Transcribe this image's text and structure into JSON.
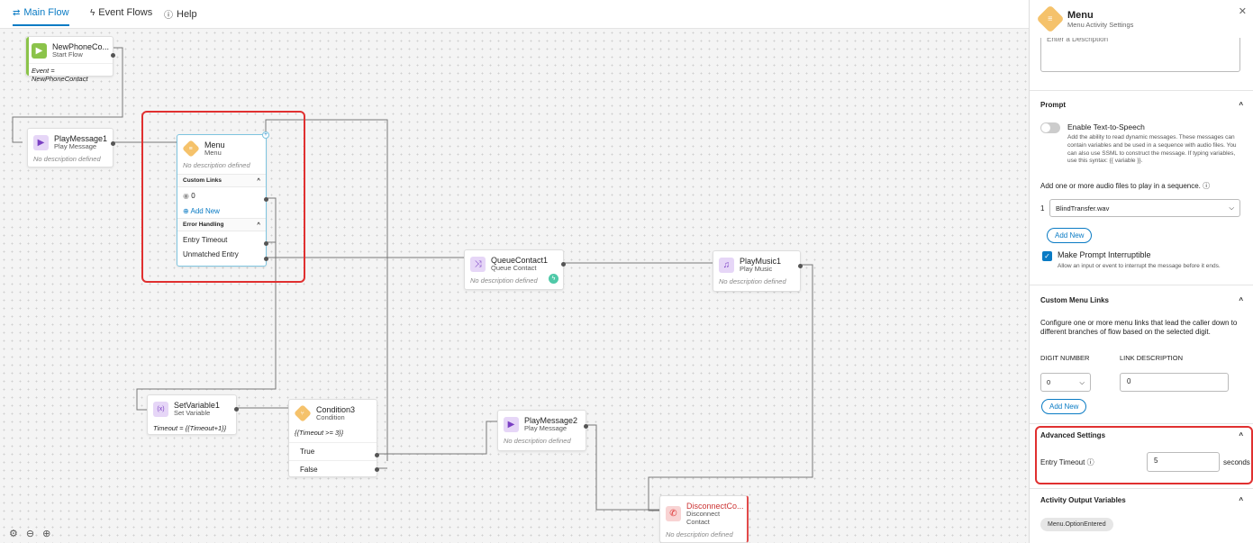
{
  "tabs": [
    {
      "label": "Main Flow",
      "icon": "flow-icon"
    },
    {
      "label": "Event Flows",
      "icon": "lightning-icon"
    },
    {
      "label": "Help",
      "icon": "help-icon"
    }
  ],
  "nodes": {
    "start": {
      "title": "NewPhoneCo...",
      "subtitle": "Start Flow",
      "expr": "Event = NewPhoneContact"
    },
    "playmsg1": {
      "title": "PlayMessage1",
      "subtitle": "Play Message",
      "desc": "No description defined"
    },
    "menu": {
      "title": "Menu",
      "subtitle": "Menu",
      "desc": "No description defined",
      "custom_links": "Custom Links",
      "link0": "0",
      "add_new": "Add New",
      "error_handling": "Error Handling",
      "entry_timeout": "Entry Timeout",
      "unmatched_entry": "Unmatched Entry"
    },
    "queue": {
      "title": "QueueContact1",
      "subtitle": "Queue Contact",
      "desc": "No description defined"
    },
    "playmusic": {
      "title": "PlayMusic1",
      "subtitle": "Play Music",
      "desc": "No description defined"
    },
    "setvar": {
      "title": "SetVariable1",
      "subtitle": "Set Variable",
      "expr": "Timeout = {{Timeout+1}}"
    },
    "condition": {
      "title": "Condition3",
      "subtitle": "Condition",
      "expr": "{{Timeout >= 3}}",
      "true_label": "True",
      "false_label": "False"
    },
    "playmsg2": {
      "title": "PlayMessage2",
      "subtitle": "Play Message",
      "desc": "No description defined"
    },
    "disconnect": {
      "title": "DisconnectCo...",
      "subtitle": "Disconnect",
      "subtitle2": "Contact",
      "desc": "No description defined"
    }
  },
  "panel": {
    "title": "Menu",
    "subtitle": "Menu Activity Settings",
    "description_placeholder": "Enter a Description",
    "prompt": {
      "heading": "Prompt",
      "tts_label": "Enable Text-to-Speech",
      "tts_help": "Add the ability to read dynamic messages. These messages can contain variables and be used in a sequence with audio files. You can also use SSML to construct the message. If typing variables, use this syntax: {{ variable }}.",
      "audio_label": "Add one or more audio files to play in a sequence.",
      "audio_index": "1",
      "audio_file": "BlindTransfer.wav",
      "add_new": "Add New",
      "interruptible_label": "Make Prompt Interruptible",
      "interruptible_help": "Allow an input or event to interrupt the message before it ends."
    },
    "custom_menu_links": {
      "heading": "Custom Menu Links",
      "help": "Configure one or more menu links that lead the caller down to different branches of flow based on the selected digit.",
      "col_digit": "DIGIT NUMBER",
      "col_desc": "LINK DESCRIPTION",
      "digit_value": "0",
      "desc_value": "0",
      "add_new": "Add New"
    },
    "advanced": {
      "heading": "Advanced Settings",
      "entry_timeout_label": "Entry Timeout",
      "entry_timeout_value": "5",
      "unit": "seconds"
    },
    "output": {
      "heading": "Activity Output Variables",
      "chip": "Menu.OptionEntered"
    }
  },
  "colors": {
    "accent": "#0a7bc4",
    "highlight": "#e03030",
    "menu_icon": "#f5c26b",
    "disconnect_accent": "#e24a4a"
  }
}
